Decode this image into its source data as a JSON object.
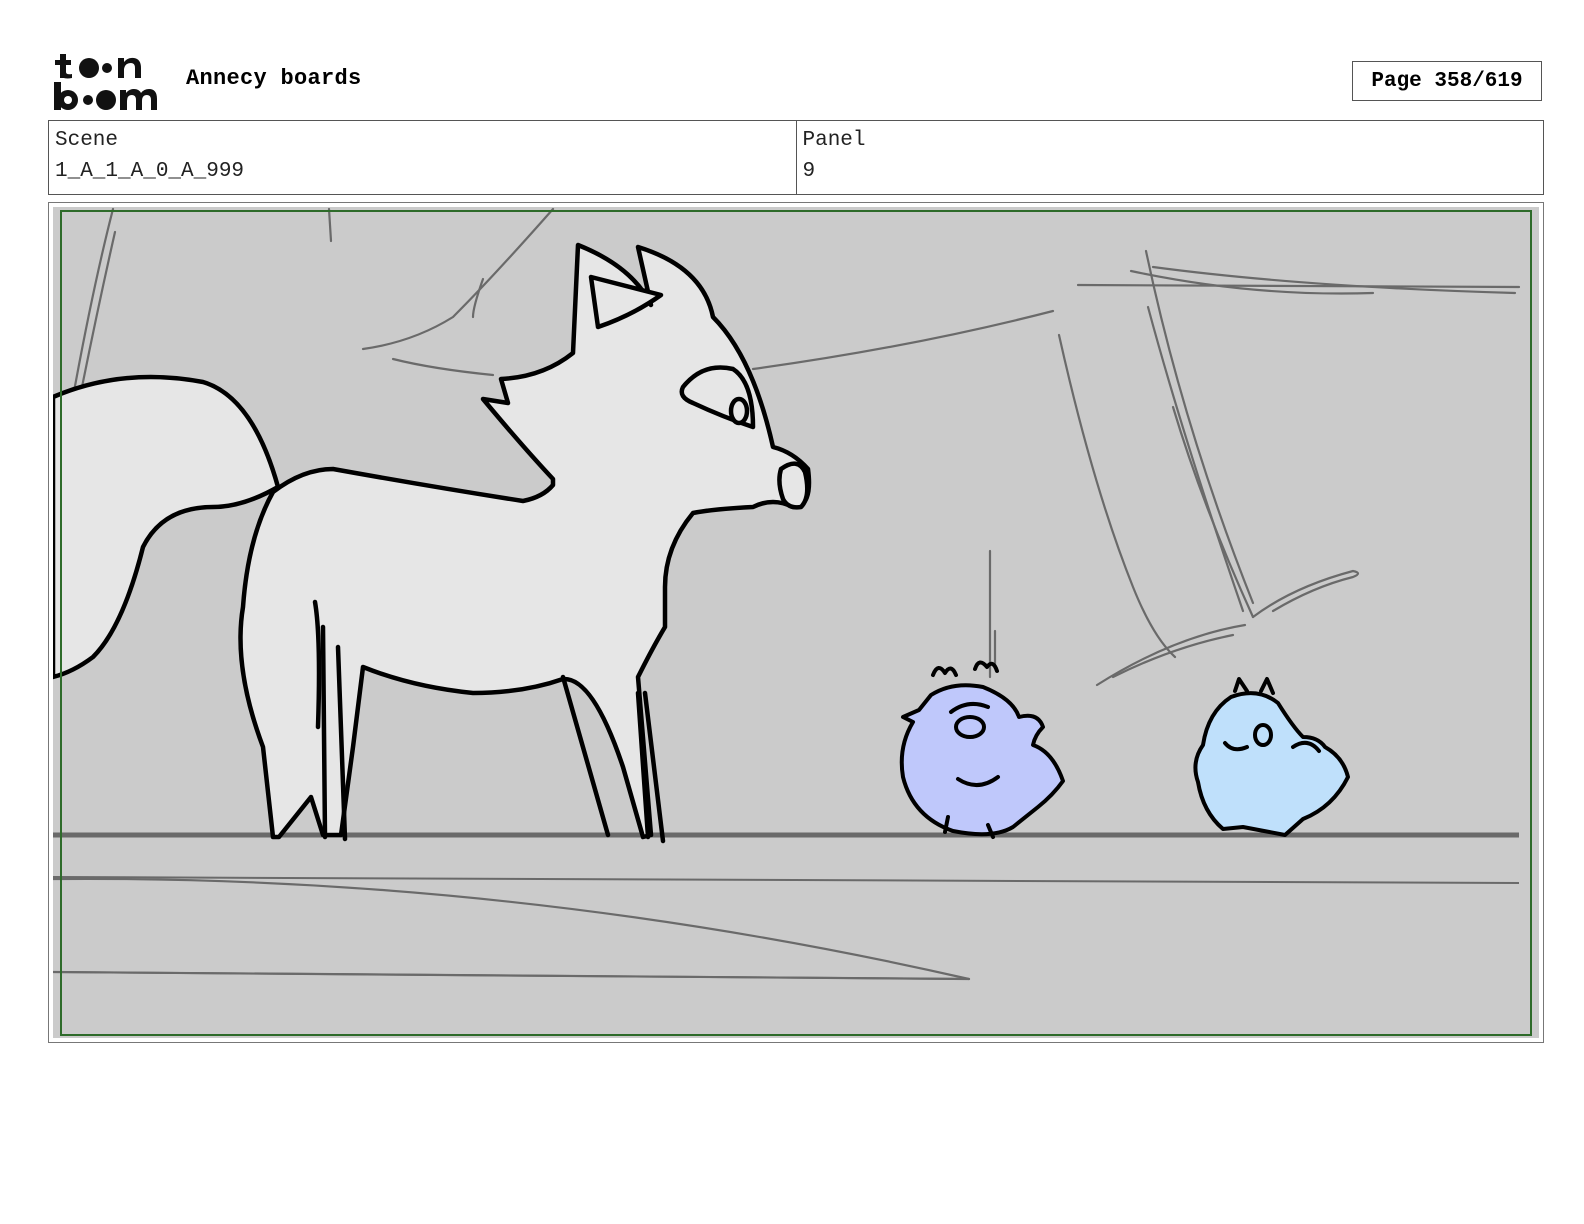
{
  "header": {
    "logo_text": "toon boom",
    "title": "Annecy boards",
    "page_label": "Page 358/619"
  },
  "info": {
    "scene_label": "Scene",
    "scene_value": "1_A_1_A_0_A_999",
    "panel_label": "Panel",
    "panel_value": "9"
  },
  "colors": {
    "background": "#cbcbcb",
    "character_fill": "#e6e6e6",
    "bird_left": "#bfc8fb",
    "bird_right": "#bfe0fb",
    "safe_frame": "#2e6b2a"
  },
  "panel": {
    "content": [
      "fox-character",
      "bird-character-left",
      "bird-character-right"
    ]
  }
}
